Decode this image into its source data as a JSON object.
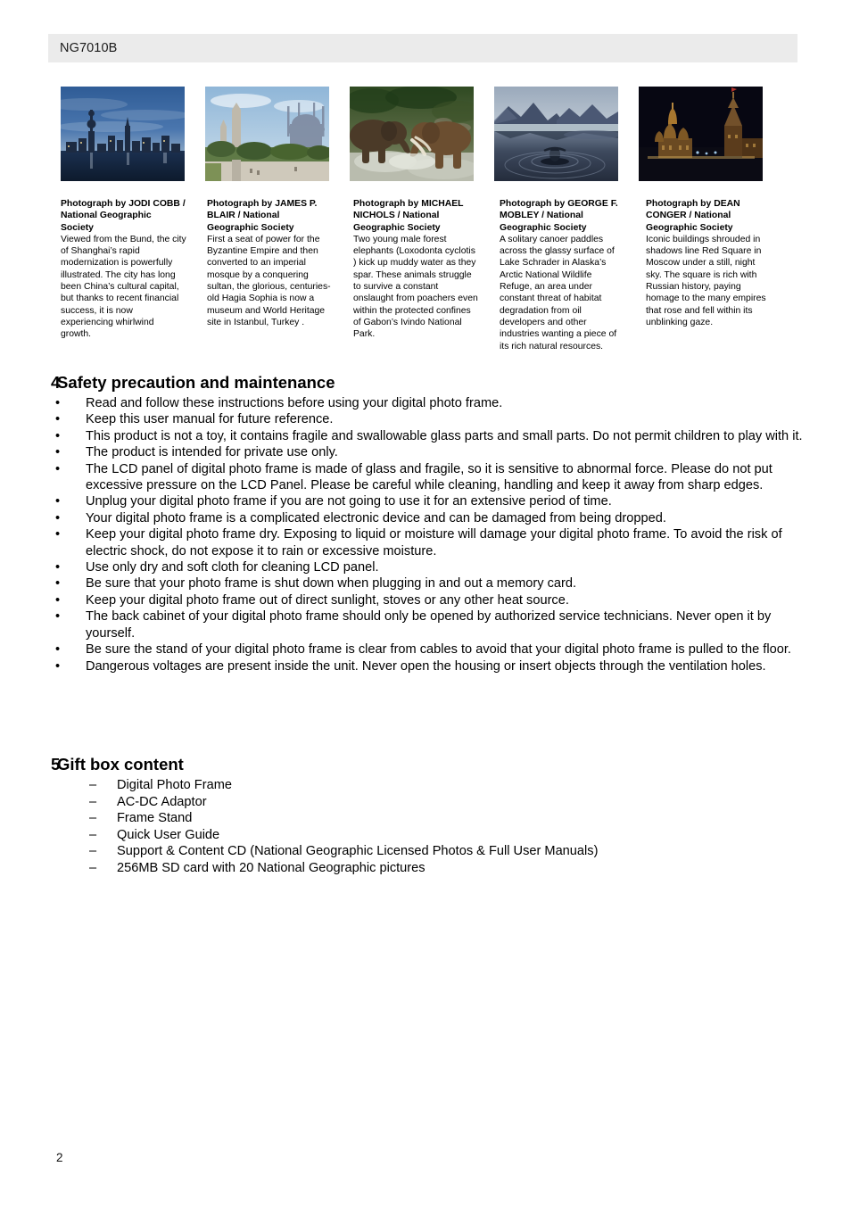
{
  "header": {
    "model": "NG7010B"
  },
  "photos": [
    {
      "name": "shanghai-skyline-photo",
      "alt": "Shanghai skyline at dusk from the Bund",
      "credit": "Photograph by JODI COBB / National Geographic Society",
      "body": "Viewed from the Bund, the city of Shanghai’s rapid modernization is powerfully illustrated. The city has long been China’s cultural capital, but thanks to recent financial success, it is now experiencing whirlwind growth."
    },
    {
      "name": "hagia-sophia-photo",
      "alt": "Hagia Sophia and obelisk in Istanbul",
      "credit": "Photograph by JAMES P. BLAIR / National Geographic Society",
      "body": "First a seat of power for the Byzantine Empire and then converted to an imperial mosque by a conquering sultan, the glorious, centuries-old Hagia Sophia is now a museum and World Heritage site in Istanbul, Turkey ."
    },
    {
      "name": "forest-elephants-photo",
      "alt": "Two forest elephants sparring in muddy water",
      "credit": "Photograph by MICHAEL NICHOLS / National Geographic Society",
      "body": "Two young male forest elephants (Loxodonta cyclotis ) kick up muddy water as they spar. These animals struggle to survive a constant onslaught from poachers even within the protected confines of Gabon’s Ivindo National Park."
    },
    {
      "name": "lake-schrader-canoe-photo",
      "alt": "Solitary canoer on Lake Schrader, Alaska",
      "credit": "Photograph by GEORGE F. MOBLEY / National Geographic Society",
      "body": "A solitary canoer paddles across the glassy surface of Lake Schrader in Alaska’s Arctic National Wildlife Refuge, an area under constant threat of habitat degradation from oil developers and other industries wanting a piece of its rich natural resources."
    },
    {
      "name": "red-square-photo",
      "alt": "Red Square in Moscow at night",
      "credit": "Photograph by DEAN CONGER / National Geographic Society",
      "body": "Iconic buildings shrouded in shadows line Red Square in Moscow under a still, night sky. The square is rich with Russian history, paying homage to the many empires that rose and fell within its unblinking gaze."
    }
  ],
  "section_safety": {
    "number": "4",
    "title": "Safety precaution and maintenance",
    "bullet_mark": "•",
    "items": [
      "Read and follow these instructions before using your digital photo frame.",
      "Keep this user manual for future reference.",
      "This product is not a toy, it contains fragile and swallowable glass parts and small parts. Do not permit children to play with it.",
      "The product is intended for private use only.",
      "The LCD panel of digital photo frame is made of glass and fragile, so it is sensitive to abnormal force. Please do not put excessive pressure on the LCD Panel. Please be careful while cleaning, handling and keep it away from sharp edges.",
      "Unplug your digital photo frame if you are not going to use it for an extensive period of time.",
      "Your digital photo frame is a complicated electronic device and can be damaged from being dropped.",
      "Keep your digital photo frame dry. Exposing to liquid or moisture will damage your digital photo frame. To avoid the risk of electric shock, do not expose it to rain or excessive moisture.",
      "Use only dry and soft cloth for cleaning LCD panel.",
      "Be sure that your photo frame is shut down when plugging in and out a memory card.",
      "Keep your digital photo frame out of direct sunlight, stoves or any other heat source.",
      "The back cabinet of your digital photo frame should only be opened by authorized service technicians. Never open it by yourself.",
      "Be sure the stand of your digital photo frame is clear from cables to avoid that your digital photo frame is pulled to the floor.",
      "Dangerous voltages are present inside the unit. Never open the housing or insert objects through the ventilation holes."
    ]
  },
  "section_giftbox": {
    "number": "5",
    "title": "Gift box content",
    "dash_mark": "–",
    "items": [
      "Digital Photo Frame",
      "AC-DC Adaptor",
      "Frame Stand",
      "Quick User Guide",
      "Support & Content CD (National Geographic Licensed Photos & Full User Manuals)",
      "256MB SD card with 20 National Geographic pictures"
    ]
  },
  "footer": {
    "page_number": "2"
  },
  "colors": {
    "header_band": "#ebebeb",
    "text": "#000000"
  }
}
